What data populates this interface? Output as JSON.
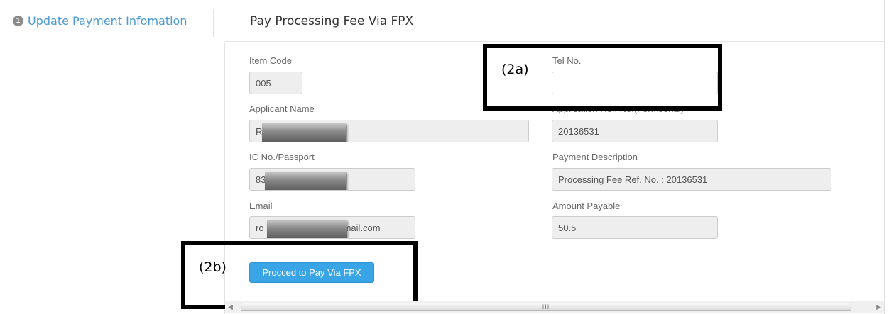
{
  "sidebar": {
    "step_number": "1",
    "step_label": "Update Payment Infomation"
  },
  "form": {
    "title": "Pay Processing Fee Via FPX",
    "item_code": {
      "label": "Item Code",
      "value": "005"
    },
    "tel_no": {
      "label": "Tel No.",
      "value": ""
    },
    "applicant_name": {
      "label": "Applicant Name",
      "value": "R"
    },
    "application_ref": {
      "label": "Application Ref. No.(Formsenal)",
      "value": "20136531"
    },
    "ic_passport": {
      "label": "IC No./Passport",
      "value": "83"
    },
    "payment_description": {
      "label": "Payment Description",
      "value": "Processing Fee Ref. No. : 20136531"
    },
    "email": {
      "label": "Email",
      "value_prefix": "ro",
      "value_suffix": "mail.com"
    },
    "amount_payable": {
      "label": "Amount Payable",
      "value": "50.5"
    },
    "submit_label": "Procced to Pay Via FPX"
  },
  "annotations": {
    "box_a": "(2a)",
    "box_b": "(2b)"
  },
  "scrollbar": {
    "grip": "III"
  },
  "colors": {
    "link": "#4a9bd4",
    "button": "#3aa5e6",
    "readonly_input": "#eeeeee"
  }
}
